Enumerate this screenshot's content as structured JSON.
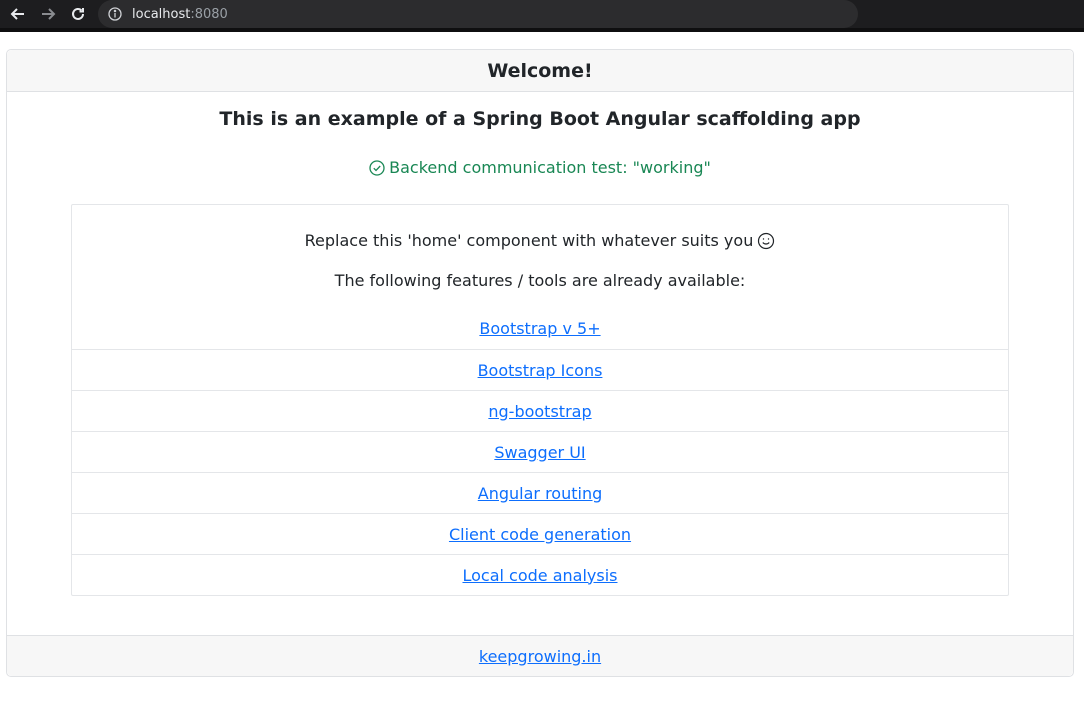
{
  "browser": {
    "url_host": "localhost",
    "url_port": ":8080"
  },
  "card": {
    "header_title": "Welcome!",
    "main_title": "This is an example of a Spring Boot Angular scaffolding app",
    "status_text": "Backend communication test: \"working\"",
    "intro_text": "Replace this 'home' component with whatever suits you",
    "features_text": "The following features / tools are already available:",
    "links": [
      {
        "label": "Bootstrap v 5+"
      },
      {
        "label": "Bootstrap Icons"
      },
      {
        "label": "ng-bootstrap"
      },
      {
        "label": "Swagger UI"
      },
      {
        "label": "Angular routing"
      },
      {
        "label": "Client code generation"
      },
      {
        "label": "Local code analysis"
      }
    ],
    "footer_link": "keepgrowing.in"
  },
  "colors": {
    "link": "#0d6efd",
    "success": "#198754",
    "header_bg": "#f7f7f7"
  },
  "icons": {
    "status": "check-circle-icon",
    "intro": "smile-emoji-icon"
  }
}
